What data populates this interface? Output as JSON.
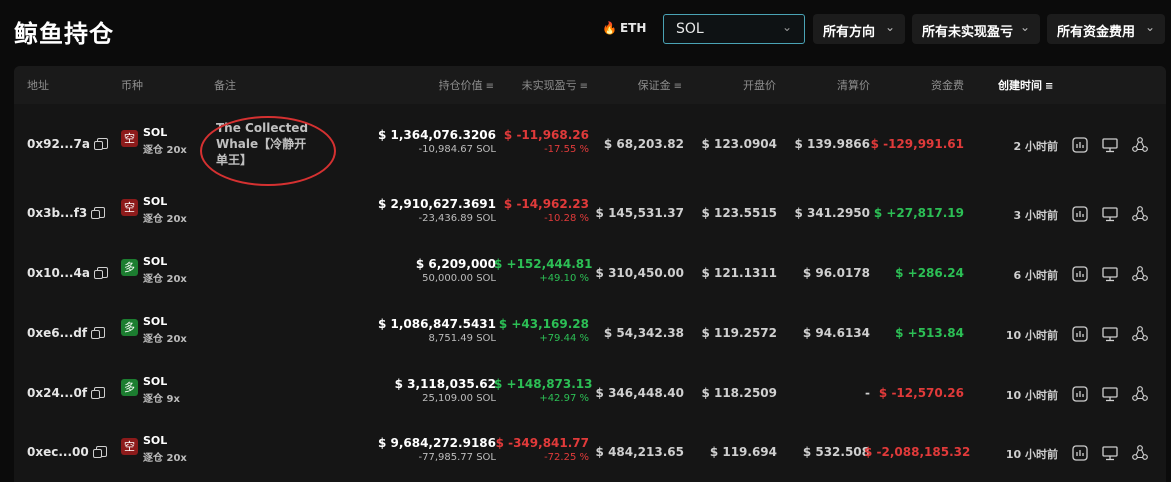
{
  "header": {
    "title": "鲸鱼持仓",
    "eth_label": "ETH",
    "symbol_value": "SOL",
    "filters": [
      "所有方向",
      "所有未实现盈亏",
      "所有资金费用"
    ]
  },
  "columns": {
    "address": "地址",
    "coin": "币种",
    "note": "备注",
    "value": "持仓价值",
    "pnl": "未实现盈亏",
    "margin": "保证金",
    "entry": "开盘价",
    "liq": "清算价",
    "funding": "资金费",
    "created": "创建时间"
  },
  "rows": [
    {
      "address": "0x92...7a",
      "side": "空",
      "side_type": "short",
      "coin": "SOL",
      "margin_mode": "逐仓 20x",
      "note": "The Collected Whale【冷静开单王】",
      "value": "$ 1,364,076.3206",
      "size": "-10,984.67 SOL",
      "pnl": "$ -11,968.26",
      "pnl_pct": "-17.55 %",
      "pnl_sign": "neg",
      "margin": "$ 68,203.82",
      "entry": "$ 123.0904",
      "liq": "$ 139.9866",
      "funding": "$ -129,991.61",
      "funding_sign": "neg",
      "created": "2 小时前"
    },
    {
      "address": "0x3b...f3",
      "side": "空",
      "side_type": "short",
      "coin": "SOL",
      "margin_mode": "逐仓 20x",
      "note": "",
      "value": "$ 2,910,627.3691",
      "size": "-23,436.89 SOL",
      "pnl": "$ -14,962.23",
      "pnl_pct": "-10.28 %",
      "pnl_sign": "neg",
      "margin": "$ 145,531.37",
      "entry": "$ 123.5515",
      "liq": "$ 341.2950",
      "funding": "$ +27,817.19",
      "funding_sign": "pos",
      "created": "3 小时前"
    },
    {
      "address": "0x10...4a",
      "side": "多",
      "side_type": "long",
      "coin": "SOL",
      "margin_mode": "逐仓 20x",
      "note": "",
      "value": "$ 6,209,000",
      "size": "50,000.00 SOL",
      "pnl": "$ +152,444.81",
      "pnl_pct": "+49.10 %",
      "pnl_sign": "pos",
      "margin": "$ 310,450.00",
      "entry": "$ 121.1311",
      "liq": "$ 96.0178",
      "funding": "$ +286.24",
      "funding_sign": "pos",
      "created": "6 小时前"
    },
    {
      "address": "0xe6...df",
      "side": "多",
      "side_type": "long",
      "coin": "SOL",
      "margin_mode": "逐仓 20x",
      "note": "",
      "value": "$ 1,086,847.5431",
      "size": "8,751.49 SOL",
      "pnl": "$ +43,169.28",
      "pnl_pct": "+79.44 %",
      "pnl_sign": "pos",
      "margin": "$ 54,342.38",
      "entry": "$ 119.2572",
      "liq": "$ 94.6134",
      "funding": "$ +513.84",
      "funding_sign": "pos",
      "created": "10 小时前"
    },
    {
      "address": "0x24...0f",
      "side": "多",
      "side_type": "long",
      "coin": "SOL",
      "margin_mode": "逐仓 9x",
      "note": "",
      "value": "$ 3,118,035.62",
      "size": "25,109.00 SOL",
      "pnl": "$ +148,873.13",
      "pnl_pct": "+42.97 %",
      "pnl_sign": "pos",
      "margin": "$ 346,448.40",
      "entry": "$ 118.2509",
      "liq": "-",
      "funding": "$ -12,570.26",
      "funding_sign": "neg",
      "created": "10 小时前"
    },
    {
      "address": "0xec...00",
      "side": "空",
      "side_type": "short",
      "coin": "SOL",
      "margin_mode": "逐仓 20x",
      "note": "",
      "value": "$ 9,684,272.9186",
      "size": "-77,985.77 SOL",
      "pnl": "$ -349,841.77",
      "pnl_pct": "-72.25 %",
      "pnl_sign": "neg",
      "margin": "$ 484,213.65",
      "entry": "$ 119.694",
      "liq": "$ 532.508",
      "funding": "$ -2,088,185.32",
      "funding_sign": "neg",
      "created": "10 小时前"
    }
  ],
  "row_actions": [
    "chart-icon",
    "monitor-icon",
    "share-icon"
  ],
  "colors": {
    "negative": "#e03a3a",
    "positive": "#2cbf55",
    "short_badge": "#8c1b1b",
    "long_badge": "#1c7d30",
    "annotation": "#d53131",
    "select_border": "#4aa3b5"
  }
}
